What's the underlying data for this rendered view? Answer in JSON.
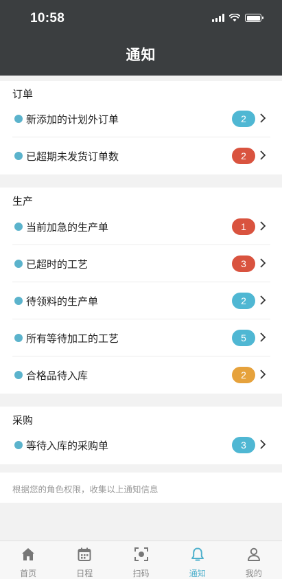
{
  "status_bar": {
    "time": "10:58"
  },
  "header": {
    "title": "通知"
  },
  "colors": {
    "accent": "#5bb3cc",
    "badge_blue": "#4fb7d3",
    "badge_red": "#d9533f",
    "badge_orange": "#e6a23c"
  },
  "sections": [
    {
      "title": "订单",
      "items": [
        {
          "label": "新添加的计划外订单",
          "count": "2",
          "badge_color": "blue"
        },
        {
          "label": "已超期未发货订单数",
          "count": "2",
          "badge_color": "red"
        }
      ]
    },
    {
      "title": "生产",
      "items": [
        {
          "label": "当前加急的生产单",
          "count": "1",
          "badge_color": "red"
        },
        {
          "label": "已超时的工艺",
          "count": "3",
          "badge_color": "red"
        },
        {
          "label": "待领料的生产单",
          "count": "2",
          "badge_color": "blue"
        },
        {
          "label": "所有等待加工的工艺",
          "count": "5",
          "badge_color": "blue"
        },
        {
          "label": "合格品待入库",
          "count": "2",
          "badge_color": "orange"
        }
      ]
    },
    {
      "title": "采购",
      "items": [
        {
          "label": "等待入库的采购单",
          "count": "3",
          "badge_color": "blue"
        }
      ]
    }
  ],
  "footer_note": "根据您的角色权限，收集以上通知信息",
  "tabbar": {
    "tabs": [
      {
        "label": "首页",
        "icon": "home-icon"
      },
      {
        "label": "日程",
        "icon": "calendar-icon"
      },
      {
        "label": "扫码",
        "icon": "scan-icon"
      },
      {
        "label": "通知",
        "icon": "bell-icon",
        "active": true
      },
      {
        "label": "我的",
        "icon": "user-icon"
      }
    ]
  }
}
